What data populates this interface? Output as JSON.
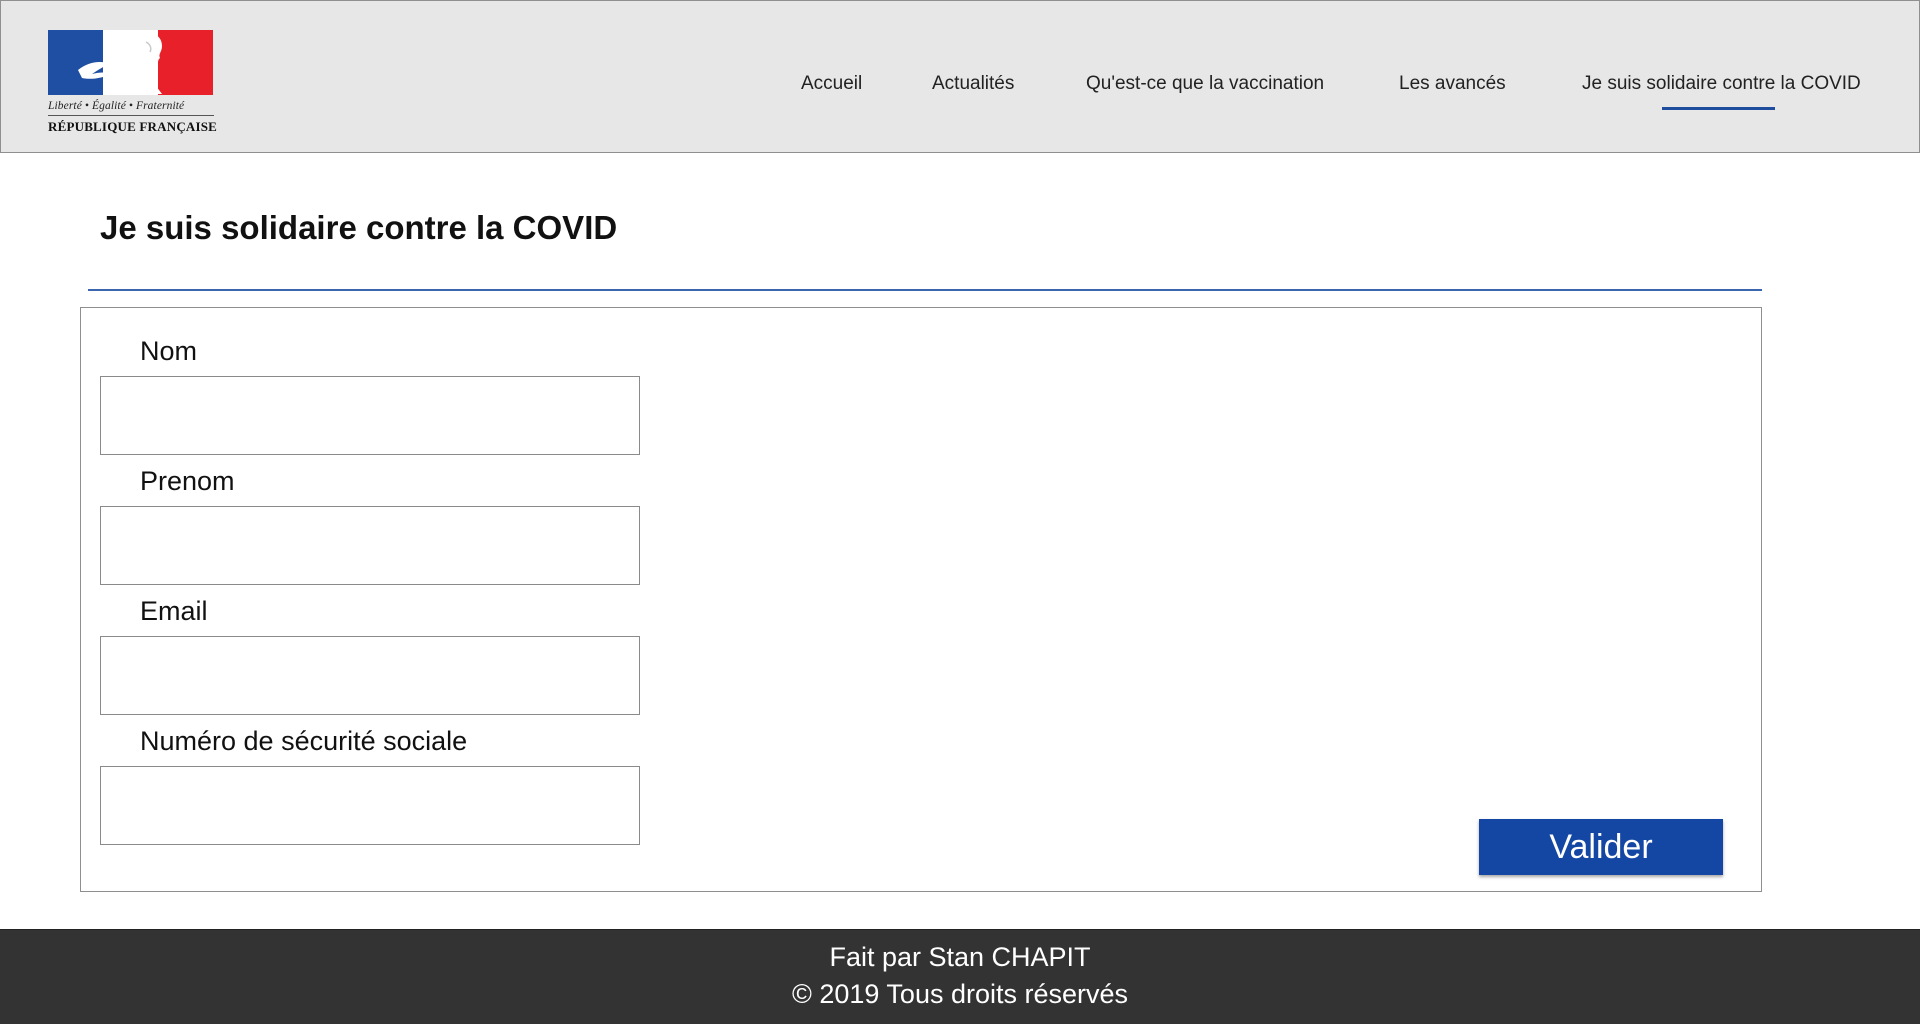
{
  "header": {
    "logo": {
      "motto": "Liberté • Égalité • Fraternité",
      "name": "RÉPUBLIQUE FRANÇAISE"
    },
    "nav": [
      {
        "label": "Accueil"
      },
      {
        "label": "Actualités"
      },
      {
        "label": "Qu'est-ce que la vaccination"
      },
      {
        "label": "Les avancés"
      },
      {
        "label": "Je suis solidaire contre la COVID",
        "active": true
      }
    ]
  },
  "main": {
    "title": "Je suis solidaire contre la COVID",
    "form": {
      "fields": [
        {
          "label": "Nom",
          "value": ""
        },
        {
          "label": "Prenom",
          "value": ""
        },
        {
          "label": "Email",
          "value": ""
        },
        {
          "label": "Numéro de sécurité sociale",
          "value": ""
        }
      ],
      "submit_label": "Valider"
    }
  },
  "footer": {
    "line1": "Fait par Stan CHAPIT",
    "line2": "© 2019 Tous droits réservés"
  },
  "colors": {
    "accent": "#1e4d9e",
    "button": "#1447a3",
    "header_bg": "#e7e7e7",
    "footer_bg": "#333333",
    "flag_blue": "#1f4fa3",
    "flag_red": "#e8202a"
  }
}
